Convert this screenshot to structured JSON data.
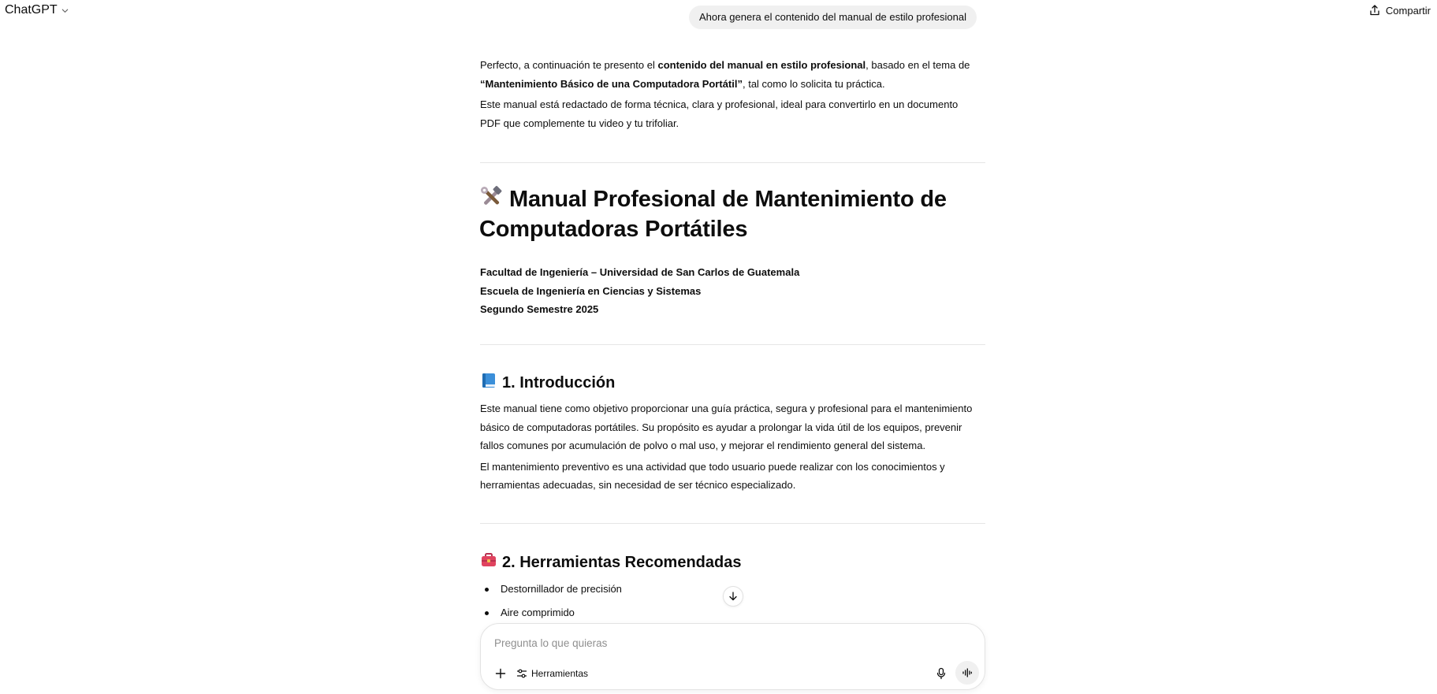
{
  "header": {
    "app_title": "ChatGPT",
    "share_label": "Compartir"
  },
  "user_message": "Ahora genera el contenido del manual de estilo profesional",
  "assistant": {
    "intro_p1_a": "Perfecto, a continuación te presento el ",
    "intro_p1_b": "contenido del manual en estilo profesional",
    "intro_p1_c": ", basado en el tema de",
    "intro_p1_d": "“Mantenimiento Básico de una Computadora Portátil”",
    "intro_p1_e": ", tal como lo solicita tu práctica.",
    "intro_p2_line1": "Este manual está redactado de forma técnica, clara y profesional, ideal para convertirlo en un documento",
    "intro_p2_line2": "PDF que complemente tu video y tu trifoliar.",
    "h1_line1": "Manual Profesional de Mantenimiento de",
    "h1_line2": "Computadoras Portátiles",
    "meta_line1": "Facultad de Ingeniería – Universidad de San Carlos de Guatemala",
    "meta_line2": "Escuela de Ingeniería en Ciencias y Sistemas",
    "meta_line3": "Segundo Semestre 2025",
    "section1_title": "1. Introducción",
    "section1_p1_line1": "Este manual tiene como objetivo proporcionar una guía práctica, segura y profesional para el mantenimiento",
    "section1_p1_line2": "básico de computadoras portátiles. Su propósito es ayudar a prolongar la vida útil de los equipos, prevenir",
    "section1_p1_line3": "fallos comunes por acumulación de polvo o mal uso, y mejorar el rendimiento general del sistema.",
    "section1_p2_line1": "El mantenimiento preventivo es una actividad que todo usuario puede realizar con los conocimientos y",
    "section1_p2_line2": "herramientas adecuadas, sin necesidad de ser técnico especializado.",
    "section2_title": "2. Herramientas Recomendadas",
    "tools_list": [
      "Destornillador de precisión",
      "Aire comprimido"
    ]
  },
  "composer": {
    "placeholder": "Pregunta lo que quieras",
    "tools_label": "Herramientas"
  },
  "icons": {
    "title_emoji": "hammer-and-wrench-icon",
    "section1_emoji": "blue-book-icon",
    "section2_emoji": "toolbox-icon"
  }
}
